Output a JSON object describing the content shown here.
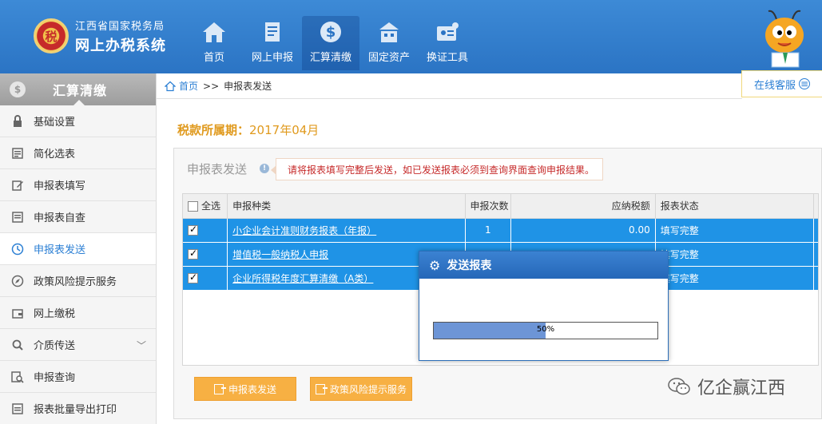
{
  "header": {
    "org": "江西省国家税务局",
    "system": "网上办税系统",
    "emblem_text": "税",
    "nav": [
      {
        "label": "首页",
        "icon": "home-icon"
      },
      {
        "label": "网上申报",
        "icon": "document-icon"
      },
      {
        "label": "汇算清缴",
        "icon": "dollar-icon",
        "active": true
      },
      {
        "label": "固定资产",
        "icon": "building-icon"
      },
      {
        "label": "换证工具",
        "icon": "certificate-icon"
      }
    ]
  },
  "online_service": "在线客服",
  "sidebar": {
    "title": "汇算清缴",
    "coin": "$",
    "items": [
      {
        "label": "基础设置",
        "icon": "lock-icon"
      },
      {
        "label": "简化选表",
        "icon": "list-icon"
      },
      {
        "label": "申报表填写",
        "icon": "edit-icon"
      },
      {
        "label": "申报表自查",
        "icon": "check-doc-icon"
      },
      {
        "label": "申报表发送",
        "icon": "send-icon",
        "active": true
      },
      {
        "label": "政策风险提示服务",
        "icon": "compass-icon"
      },
      {
        "label": "网上缴税",
        "icon": "wallet-icon"
      },
      {
        "label": "介质传送",
        "icon": "search-icon",
        "expandable": true
      },
      {
        "label": "申报查询",
        "icon": "query-icon"
      },
      {
        "label": "报表批量导出打印",
        "icon": "print-icon"
      }
    ]
  },
  "breadcrumb": {
    "home": "首页",
    "sep": ">>",
    "current": "申报表发送"
  },
  "period": {
    "label": "税款所属期：",
    "value": "2017年04月"
  },
  "panel": {
    "title": "申报表发送",
    "info_mark": "!",
    "notice": "请将报表填写完整后发送，如已发送报表必须到查询界面查询申报结果。",
    "table": {
      "headers": [
        "全选",
        "申报种类",
        "申报次数",
        "应纳税额",
        "报表状态"
      ],
      "rows": [
        {
          "kind": "小企业会计准则财务报表（年报）",
          "count": "1",
          "tax": "0.00",
          "status": "填写完整"
        },
        {
          "kind": "增值税一般纳税人申报",
          "count": "",
          "tax": "",
          "status": "填写完整"
        },
        {
          "kind": "企业所得税年度汇算清缴（A类）",
          "count": "",
          "tax": "",
          "status": "填写完整"
        }
      ]
    },
    "buttons": {
      "send": "申报表发送",
      "policy": "政策风险提示服务"
    }
  },
  "modal": {
    "title": "发送报表",
    "progress": 50,
    "progress_text": "50%"
  },
  "watermark": "亿企赢江西",
  "colors": {
    "header_blue": "#2b74c4",
    "row_blue": "#1f93e6",
    "accent_orange": "#f7b043",
    "notice_red": "#c62a2a",
    "period_orange": "#e09a1e"
  }
}
